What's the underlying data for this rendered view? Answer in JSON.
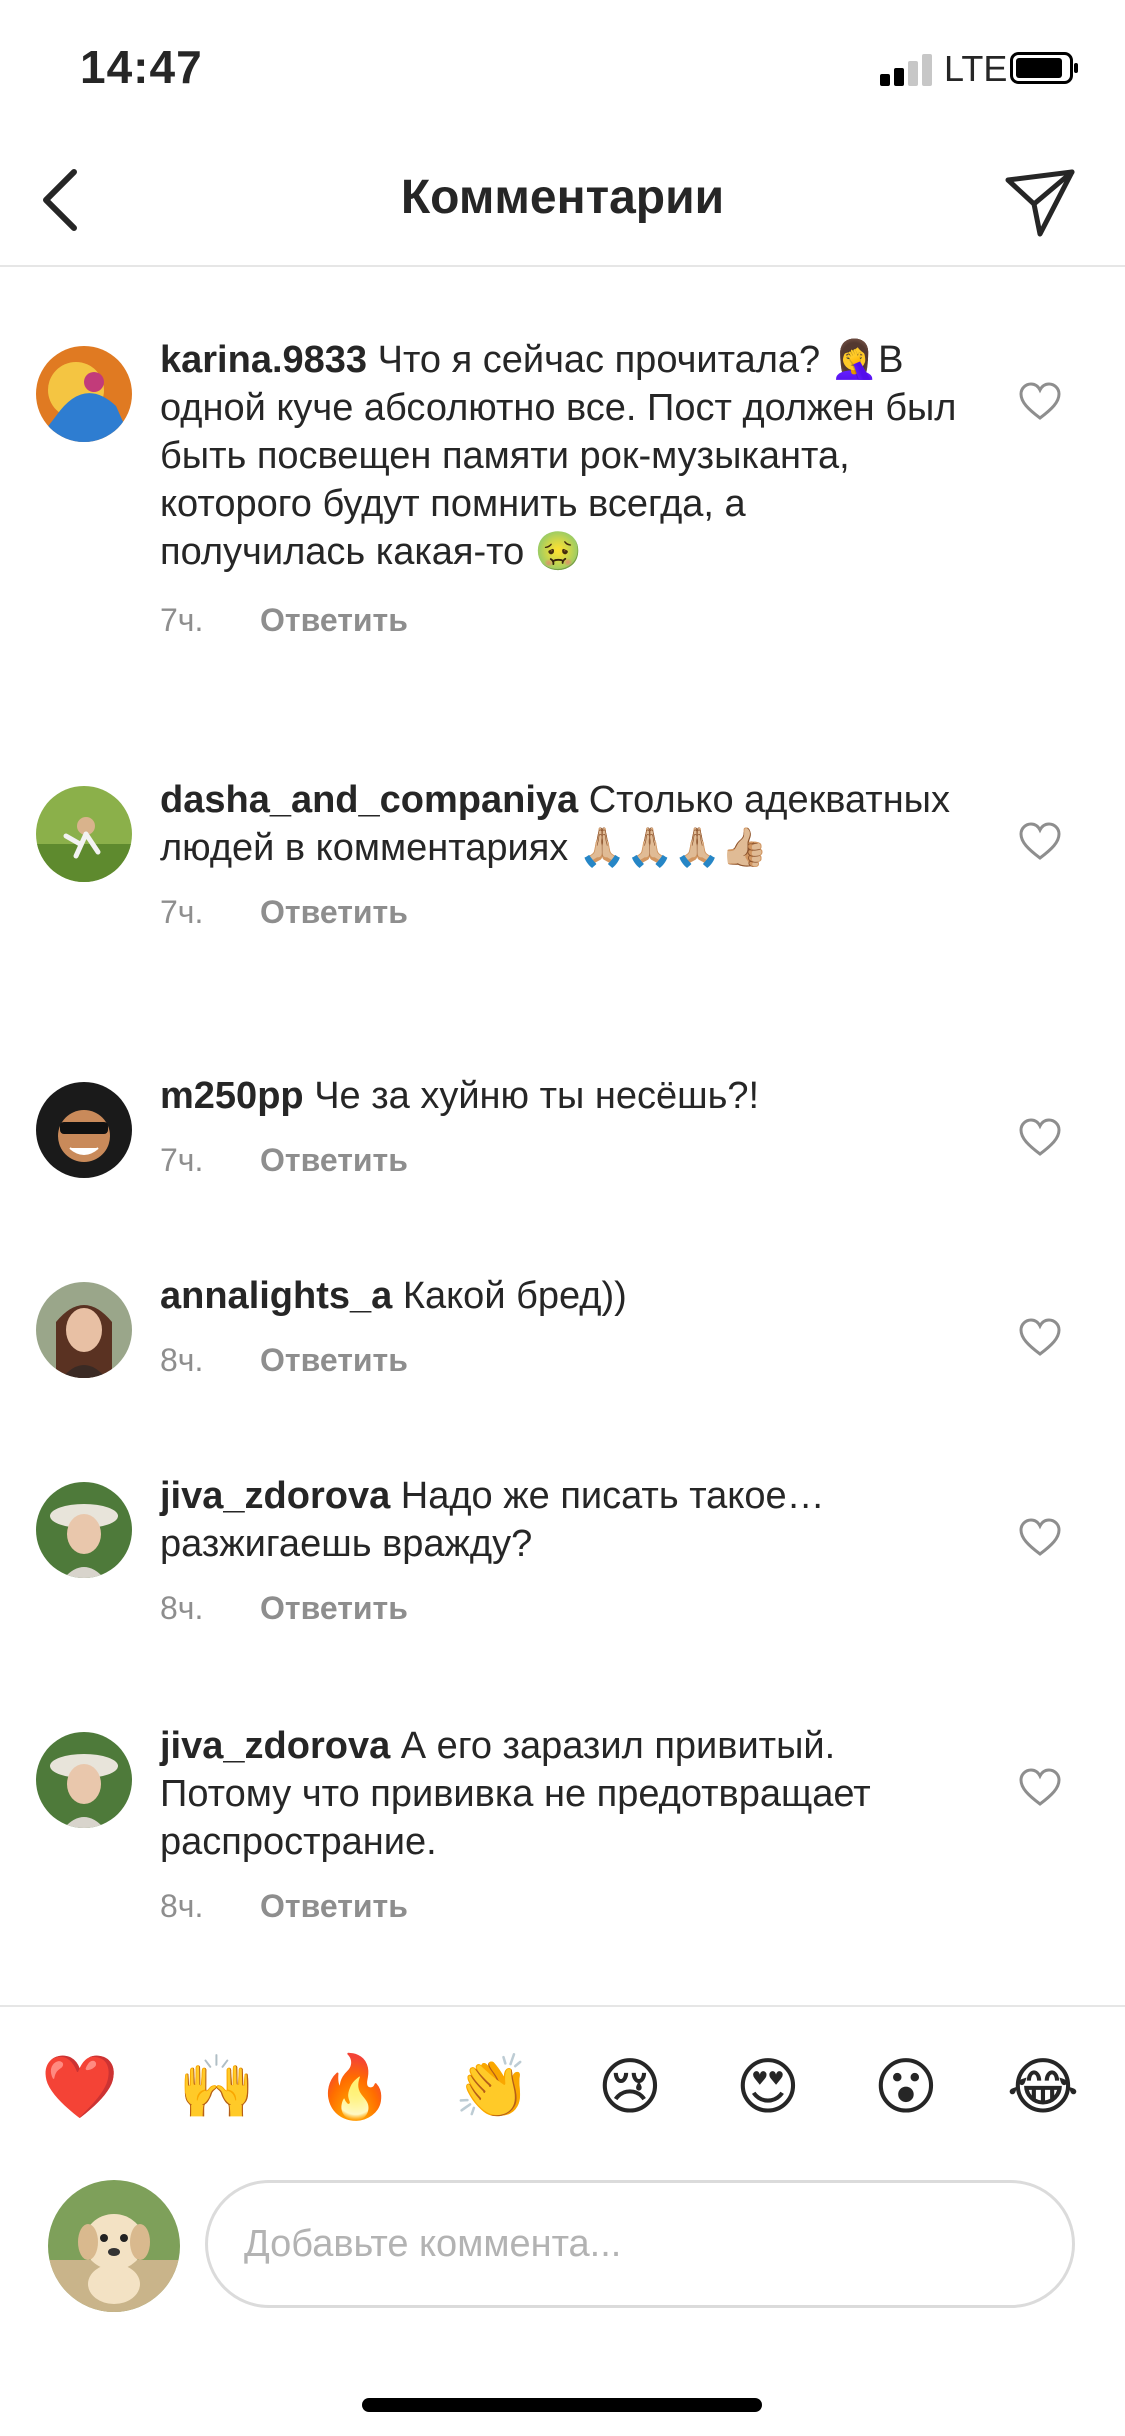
{
  "status_bar": {
    "time": "14:47",
    "network": "LTE"
  },
  "header": {
    "title": "Комментарии"
  },
  "comments": [
    {
      "username": "karina.9833",
      "text": "Что я сейчас прочитала? 🤦‍♀️В одной куче абсолютно все. Пост должен был быть посвещен памяти рок-музыканта, которого будут помнить всегда, а получилась какая-то 🤢",
      "time": "7ч.",
      "reply_label": "Ответить"
    },
    {
      "username": "dasha_and_companiya",
      "text": "Столько адекватных людей в комментариях 🙏🏼🙏🏼🙏🏼👍🏼",
      "time": "7ч.",
      "reply_label": "Ответить"
    },
    {
      "username": "m250pp",
      "text": "Че за хуйню ты несёшь?!",
      "time": "7ч.",
      "reply_label": "Ответить"
    },
    {
      "username": "annalights_a",
      "text": "Какой бред))",
      "time": "8ч.",
      "reply_label": "Ответить"
    },
    {
      "username": "jiva_zdorova",
      "text": "Надо же писать такое… разжигаешь вражду?",
      "time": "8ч.",
      "reply_label": "Ответить"
    },
    {
      "username": "jiva_zdorova",
      "text": "А его заразил привитый. Потому что прививка не предотвращает распространие.",
      "time": "8ч.",
      "reply_label": "Ответить"
    }
  ],
  "quick_emojis": [
    "❤️",
    "🙌",
    "🔥",
    "👏",
    "😢",
    "😍",
    "😮",
    "😂"
  ],
  "composer": {
    "placeholder": "Добавьте коммента..."
  },
  "colors": {
    "text": "#262626",
    "secondary": "#8e8e8e",
    "divider": "#e6e6e6",
    "heart_red": "#ed4956"
  }
}
